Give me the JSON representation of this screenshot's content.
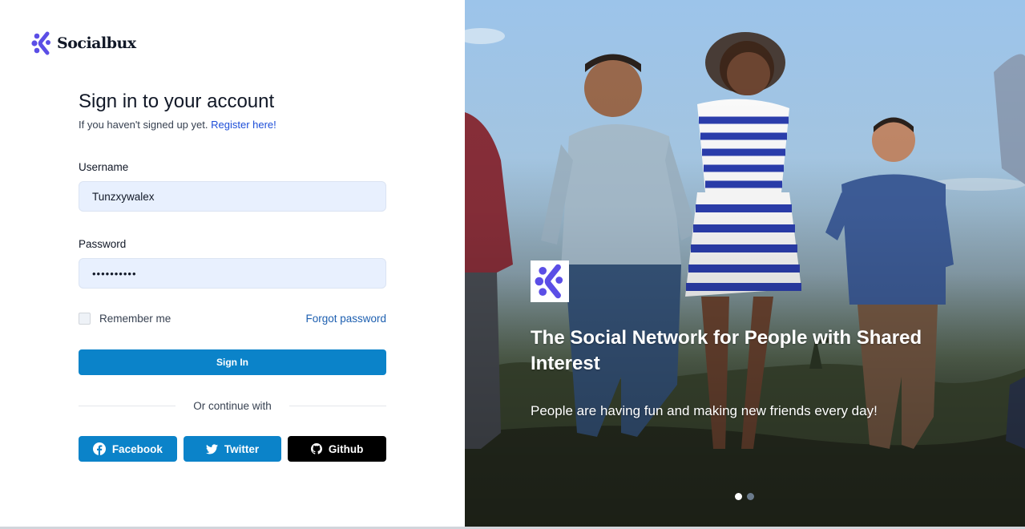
{
  "brand": {
    "name": "Socialbux",
    "accent": "#5b4ee6"
  },
  "form": {
    "title": "Sign in to your account",
    "subtitle_prefix": "If you haven't signed up yet.",
    "register_link": "Register here!",
    "username_label": "Username",
    "username_value": "Tunzxywalex",
    "password_label": "Password",
    "password_value": "••••••••••",
    "remember_label": "Remember me",
    "forgot_link": "Forgot password",
    "signin_label": "Sign In",
    "divider_text": "Or continue with",
    "primary_color": "#0b83c9"
  },
  "socials": {
    "facebook_label": "Facebook",
    "twitter_label": "Twitter",
    "github_label": "Github"
  },
  "hero": {
    "title": "The Social Network for People with Shared Interest",
    "text": "People are having fun and making new friends every day!",
    "active_slide": 1,
    "slide_count": 2
  }
}
